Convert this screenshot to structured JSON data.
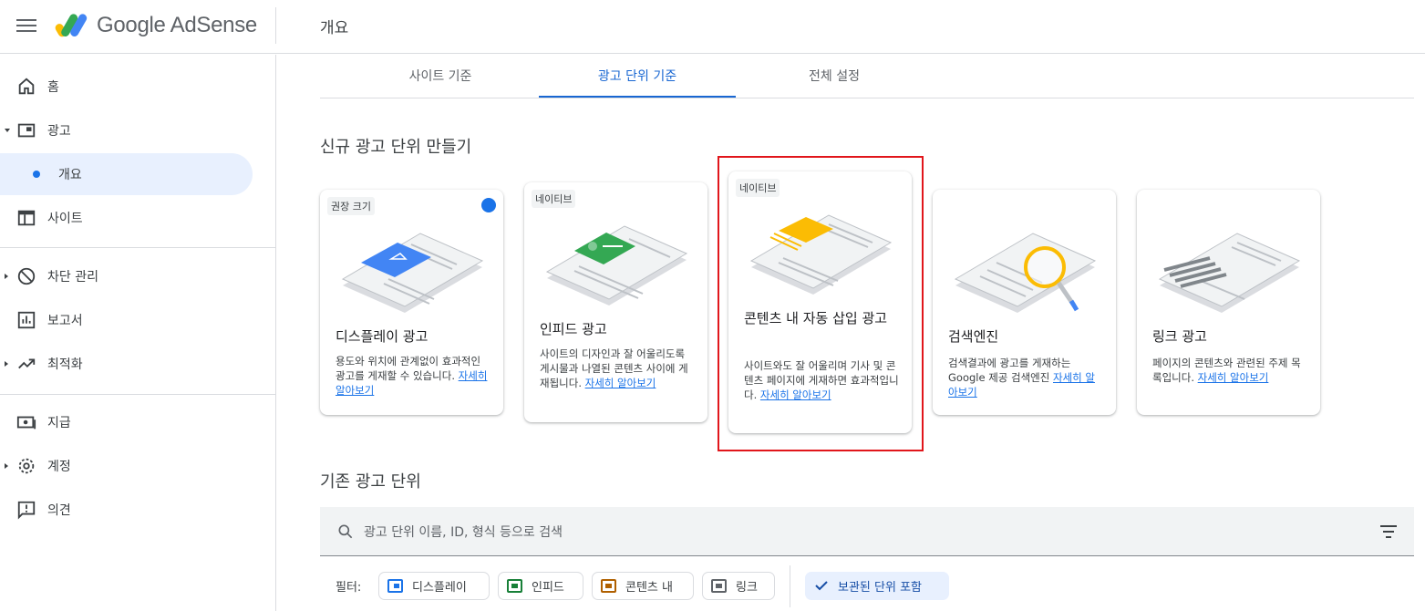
{
  "app": {
    "brand": "Google AdSense",
    "page_title": "개요"
  },
  "sidebar": {
    "items": [
      {
        "label": "홈"
      },
      {
        "label": "광고"
      },
      {
        "label": "개요"
      },
      {
        "label": "사이트"
      },
      {
        "label": "차단 관리"
      },
      {
        "label": "보고서"
      },
      {
        "label": "최적화"
      },
      {
        "label": "지급"
      },
      {
        "label": "계정"
      },
      {
        "label": "의견"
      }
    ]
  },
  "tabs": [
    {
      "label": "사이트 기준",
      "active": false
    },
    {
      "label": "광고 단위 기준",
      "active": true
    },
    {
      "label": "전체 설정",
      "active": false
    }
  ],
  "new_section": {
    "title": "신규 광고 단위 만들기"
  },
  "cards": [
    {
      "tag": "권장 크기",
      "title": "디스플레이 광고",
      "desc": "용도와 위치에 관계없이 효과적인 광고를 게재할 수 있습니다.",
      "link": "자세히 알아보기",
      "accent": "#4285f4"
    },
    {
      "tag": "네이티브",
      "title": "인피드 광고",
      "desc": "사이트의 디자인과 잘 어울리도록 게시물과 나열된 콘텐츠 사이에 게재됩니다.",
      "link": "자세히 알아보기",
      "accent": "#34a853"
    },
    {
      "tag": "네이티브",
      "title": "콘텐츠 내 자동 삽입 광고",
      "desc": "사이트와도 잘 어울리며 기사 및 콘텐츠 페이지에 게재하면 효과적입니다.",
      "link": "자세히 알아보기",
      "accent": "#fbbc04"
    },
    {
      "tag": "",
      "title": "검색엔진",
      "desc": "검색결과에 광고를 게재하는 Google 제공 검색엔진",
      "link": "자세히 알아보기",
      "accent": "#fbbc04"
    },
    {
      "tag": "",
      "title": "링크 광고",
      "desc": "페이지의 콘텐츠와 관련된 주제 목록입니다.",
      "link": "자세히 알아보기",
      "accent": "#5f6368"
    }
  ],
  "existing_section": {
    "title": "기존 광고 단위"
  },
  "search": {
    "placeholder": "광고 단위 이름, ID, 형식 등으로 검색"
  },
  "filters": {
    "label": "필터:",
    "chips": [
      {
        "label": "디스플레이",
        "color": "#1a73e8"
      },
      {
        "label": "인피드",
        "color": "#188038"
      },
      {
        "label": "콘텐츠 내",
        "color": "#b06000"
      },
      {
        "label": "링크",
        "color": "#5f6368"
      }
    ],
    "saved": "보관된 단위 포함"
  },
  "colors": {
    "accent": "#1a73e8",
    "highlight": "#e1161b"
  }
}
